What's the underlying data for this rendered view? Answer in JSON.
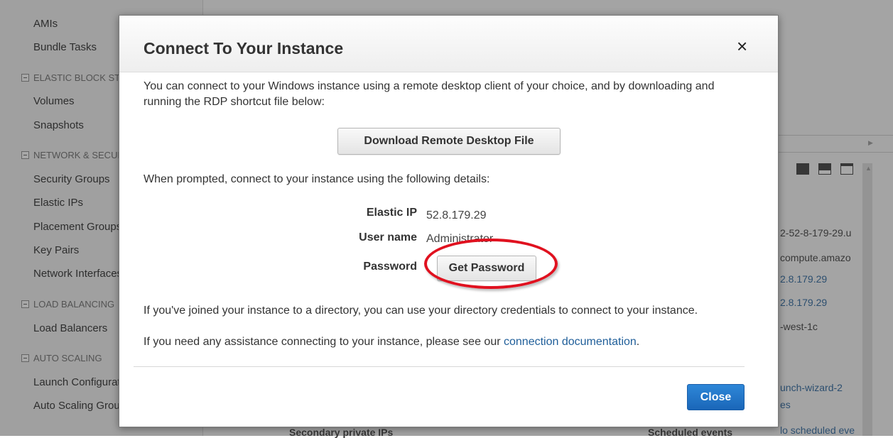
{
  "sidebar": {
    "items": [
      {
        "type": "item",
        "label": "AMIs"
      },
      {
        "type": "item",
        "label": "Bundle Tasks"
      },
      {
        "type": "section",
        "label": "ELASTIC BLOCK STORE"
      },
      {
        "type": "item",
        "label": "Volumes"
      },
      {
        "type": "item",
        "label": "Snapshots"
      },
      {
        "type": "section",
        "label": "NETWORK & SECURITY"
      },
      {
        "type": "item",
        "label": "Security Groups"
      },
      {
        "type": "item",
        "label": "Elastic IPs"
      },
      {
        "type": "item",
        "label": "Placement Groups"
      },
      {
        "type": "item",
        "label": "Key Pairs"
      },
      {
        "type": "item",
        "label": "Network Interfaces"
      },
      {
        "type": "section",
        "label": "LOAD BALANCING"
      },
      {
        "type": "item",
        "label": "Load Balancers"
      },
      {
        "type": "section",
        "label": "AUTO SCALING"
      },
      {
        "type": "item",
        "label": "Launch Configurations"
      },
      {
        "type": "item",
        "label": "Auto Scaling Groups"
      }
    ]
  },
  "background_details": {
    "values": [
      {
        "text": "2-52-8-179-29.u",
        "link": false
      },
      {
        "text": "compute.amazo",
        "link": false
      },
      {
        "text": "2.8.179.29",
        "link": true
      },
      {
        "text": "2.8.179.29",
        "link": true
      },
      {
        "text": "-west-1c",
        "link": false
      },
      {
        "text": "unch-wizard-2",
        "link": true
      },
      {
        "text": "es",
        "link": true
      },
      {
        "text": "lo scheduled eve",
        "link": true
      }
    ],
    "bottom_labels": {
      "secondary_private_ips": "Secondary private IPs",
      "scheduled_events": "Scheduled events"
    }
  },
  "modal": {
    "title": "Connect To Your Instance",
    "close_icon": "×",
    "intro": "You can connect to your Windows instance using a remote desktop client of your choice, and by downloading and running the RDP shortcut file below:",
    "download_button": "Download Remote Desktop File",
    "prompt": "When prompted, connect to your instance using the following details:",
    "details": {
      "elastic_ip_label": "Elastic IP",
      "elastic_ip_value": "52.8.179.29",
      "username_label": "User name",
      "username_value": "Administrator",
      "password_label": "Password",
      "get_password_button": "Get Password"
    },
    "directory_note": "If you've joined your instance to a directory, you can use your directory credentials to connect to your instance.",
    "help_prefix": "If you need any assistance connecting to your instance, please see our",
    "help_link": "connection documentation",
    "help_suffix": ".",
    "close_button": "Close"
  },
  "colors": {
    "primary_button": "#1f6fc5",
    "link": "#1f5e99",
    "annotation": "#e0111f"
  }
}
